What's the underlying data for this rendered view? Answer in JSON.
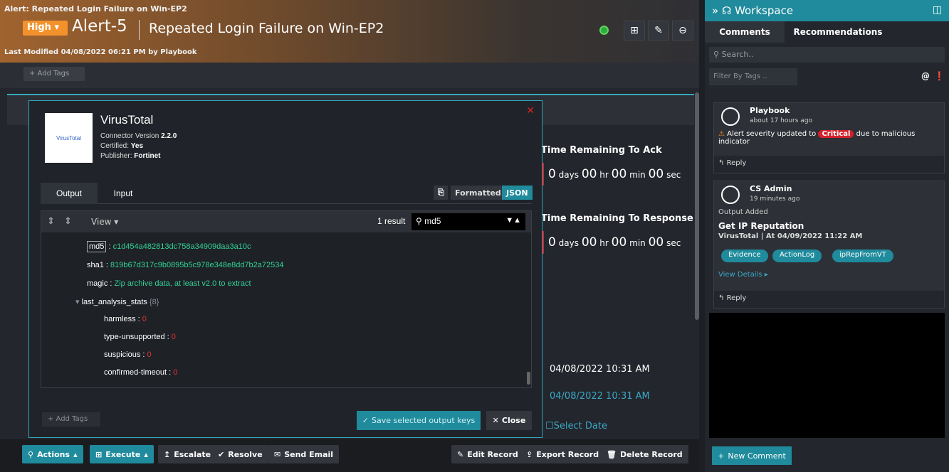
{
  "header": {
    "crumb": "Alert: Repeated Login Failure on Win-EP2",
    "severity": "High",
    "alert_id": "Alert-5",
    "alert_title": "Repeated Login Failure on Win-EP2",
    "modified": "Last Modified 04/08/2022 06:21 PM by Playbook"
  },
  "tags": {
    "add_label": "+ Add Tags"
  },
  "panels": {
    "time_ack_label": "Time Remaining To Ack",
    "time_resp_label": "Time Remaining To Response",
    "time_ack": {
      "days": "0",
      "hr": "00",
      "min": "00",
      "sec": "00"
    },
    "time_resp": {
      "days": "0",
      "hr": "00",
      "min": "00",
      "sec": "00"
    },
    "units": {
      "days": "days",
      "hr": "hr",
      "min": "min",
      "sec": "sec"
    },
    "date1": "04/08/2022 10:31 AM",
    "date2": "04/08/2022 10:31 AM",
    "select_date": "Select Date"
  },
  "modal": {
    "name": "VirusTotal",
    "logo_text": "VirusTotal",
    "connector_version_label": "Connector Version",
    "connector_version": "2.2.0",
    "certified_label": "Certified:",
    "certified": "Yes",
    "publisher_label": "Publisher:",
    "publisher": "Fortinet",
    "tabs": [
      "Output",
      "Input"
    ],
    "formatted": "Formatted",
    "json": "JSON",
    "view": "View",
    "result_count": "1 result",
    "search_value": "md5",
    "json_lines": [
      {
        "key": "md5",
        "value": "c1d454a482813dc758a34909daa3a10c"
      },
      {
        "key": "sha1",
        "value": "819b67d317c9b0895b5c978e348e8dd7b2a72534"
      },
      {
        "key": "magic",
        "value": "Zip archive data, at least v2.0 to extract"
      },
      {
        "key": "last_analysis_stats",
        "value": "{8}"
      },
      {
        "key": "harmless",
        "value": "0"
      },
      {
        "key": "type-unsupported",
        "value": "0"
      },
      {
        "key": "suspicious",
        "value": "0"
      },
      {
        "key": "confirmed-timeout",
        "value": "0"
      }
    ],
    "add_tags": "+ Add Tags",
    "save_label": "Save selected output keys",
    "close_label": "Close"
  },
  "toolbar": {
    "actions": "Actions",
    "execute": "Execute",
    "escalate": "Escalate",
    "resolve": "Resolve",
    "send_email": "Send Email",
    "edit_record": "Edit Record",
    "export_record": "Export Record",
    "delete_record": "Delete Record"
  },
  "workspace": {
    "title": "Workspace",
    "tabs": [
      "Comments",
      "Recommendations"
    ],
    "search_placeholder": "Search..",
    "filter_placeholder": "Filter By Tags ..",
    "cards": [
      {
        "name": "Playbook",
        "time": "about 17 hours ago",
        "msg_pre": "Alert severity updated to",
        "badge": "Critical",
        "msg_post": "due to malicious indicator",
        "reply": "Reply"
      },
      {
        "name": "CS Admin",
        "time": "19 minutes ago",
        "label": "Output Added",
        "title": "Get IP Reputation",
        "sub": "VirusTotal | At 04/09/2022 11:22 AM",
        "chips": [
          "Evidence",
          "ActionLog",
          "ipRepFromVT"
        ],
        "details": "View Details",
        "reply": "Reply"
      }
    ],
    "new_comment": "New Comment"
  },
  "colors": {
    "accent": "#1f8b9c",
    "severity": "#f3922c",
    "critical": "#d4212b",
    "json_value": "#32d296"
  }
}
